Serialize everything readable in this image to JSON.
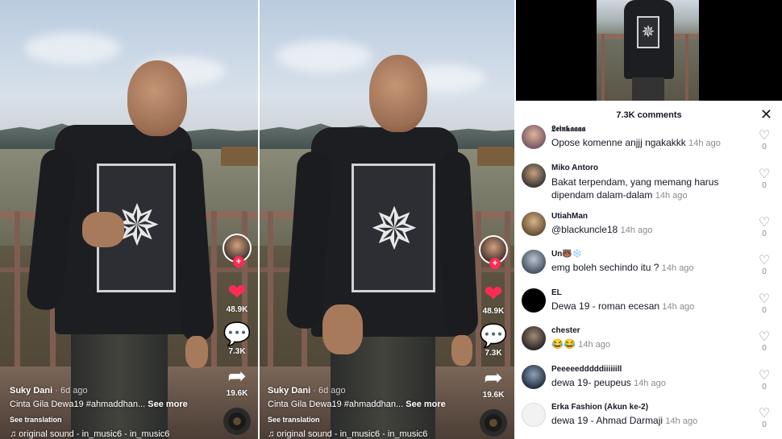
{
  "videos": [
    {
      "author": "Suky Dani",
      "time_ago": "· 6d ago",
      "description": "Cinta Gila Dewa19 #ahmaddhan...",
      "see_more": "See more",
      "translation": "See translation",
      "sound": "♫ original sound - in_music6 - in_music6",
      "likes": "48.9K",
      "comments": "7.3K",
      "shares": "19.6K",
      "follow_badge": "+"
    },
    {
      "author": "Suky Dani",
      "time_ago": "· 6d ago",
      "description": "Cinta Gila Dewa19 #ahmaddhan...",
      "see_more": "See more",
      "translation": "See translation",
      "sound": "♫ original sound - in_music6 - in_music6",
      "likes": "48.9K",
      "comments": "7.3K",
      "shares": "19.6K",
      "follow_badge": "+"
    }
  ],
  "icons": {
    "like": "heart-icon",
    "comment": "comment-bubble-icon",
    "share": "share-arrow-icon",
    "close": "close-icon",
    "comment_like": "heart-outline-icon"
  },
  "colors": {
    "tiktok_red": "#fe2c55",
    "text_primary": "#161823",
    "text_secondary": "#8a8b91"
  },
  "comments_panel": {
    "title": "7.3K comments",
    "close": "✕",
    "comments": [
      {
        "name": "𝕷𝖊𝖎𝖓𝖐𝖆𝖆𝖆𝖆",
        "text": "Opose komenne anjjj ngakakkk",
        "time": "14h ago",
        "likes": "0"
      },
      {
        "name": "Miko Antoro",
        "text": "Bakat terpendam, yang memang harus dipendam dalam-dalam",
        "time": "14h ago",
        "likes": "0"
      },
      {
        "name": "UtiahMan",
        "text": "@blackuncle18",
        "time": "14h ago",
        "likes": "0"
      },
      {
        "name": "Un🐻❄️",
        "text": "emg boleh sechindo itu ?",
        "time": "14h ago",
        "likes": "0"
      },
      {
        "name": "EL",
        "text": "Dewa 19 - roman ecesan",
        "time": "14h ago",
        "likes": "0"
      },
      {
        "name": "chester",
        "text": "😂😂",
        "time": "14h ago",
        "likes": "0"
      },
      {
        "name": "Peeeeedddddiiiiiill",
        "text": "dewa 19- peupeus",
        "time": "14h ago",
        "likes": "0"
      },
      {
        "name": "Erka Fashion (Akun ke-2)",
        "text": "dewa 19 - Ahmad Darmaji",
        "time": "14h ago",
        "likes": "0"
      }
    ]
  }
}
